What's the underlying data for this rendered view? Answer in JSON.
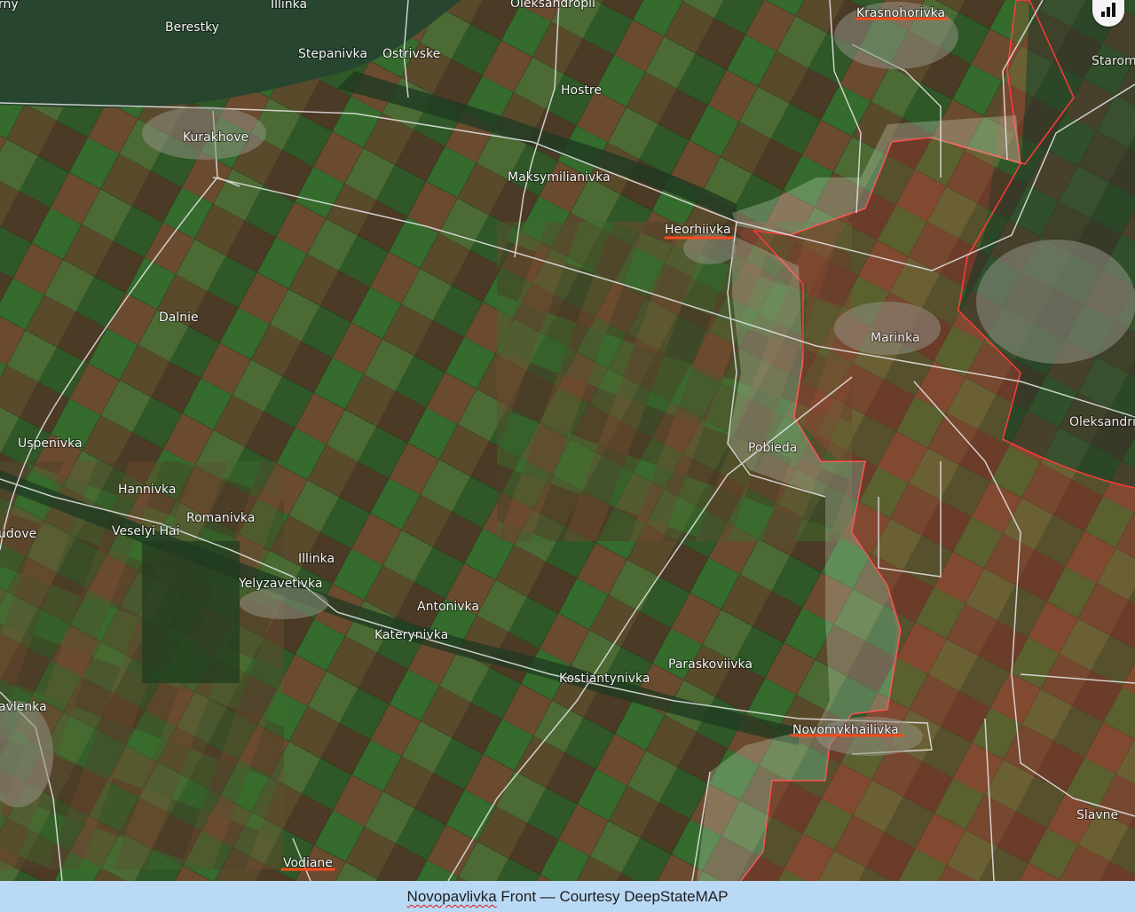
{
  "map": {
    "towns": [
      {
        "name": "rny"
      },
      {
        "name": "Illinka"
      },
      {
        "name": "Oleksandropil"
      },
      {
        "name": "Krasnohorivka",
        "highlight": true
      },
      {
        "name": "Starom"
      },
      {
        "name": "Berestky"
      },
      {
        "name": "Stepanivka"
      },
      {
        "name": "Ostrivske"
      },
      {
        "name": "Hostre"
      },
      {
        "name": "Kurakhove"
      },
      {
        "name": "Maksymilianivka"
      },
      {
        "name": "Heorhiivka",
        "highlight": true
      },
      {
        "name": "Dalnie"
      },
      {
        "name": "Marinka"
      },
      {
        "name": "Oleksandri"
      },
      {
        "name": "Uspenivka"
      },
      {
        "name": "Pobieda"
      },
      {
        "name": "Hannivka"
      },
      {
        "name": "Romanivka"
      },
      {
        "name": "Veselyi Hai"
      },
      {
        "name": "udove"
      },
      {
        "name": "Illinka"
      },
      {
        "name": "Yelyzavetivka"
      },
      {
        "name": "Antonivka"
      },
      {
        "name": "Katerynivka"
      },
      {
        "name": "Paraskoviivka"
      },
      {
        "name": "Kostiantynivka"
      },
      {
        "name": "Novomykhailivka",
        "highlight": true
      },
      {
        "name": "avlenka"
      },
      {
        "name": "Slavne"
      },
      {
        "name": "Vodiane",
        "highlight": true
      }
    ],
    "colors": {
      "occupied_fill": "#c0433a",
      "occupied_border": "#ff3b3b",
      "contested_fill": "#dcebd4",
      "roads": "#e8e8e8",
      "highlight_underline": "#ff4a1c",
      "water": "#27452f"
    },
    "stats_icon": "bar-chart-icon"
  },
  "caption": {
    "before": "Novopavlivka",
    "after": " Front — Courtesy DeepStateMAP"
  }
}
